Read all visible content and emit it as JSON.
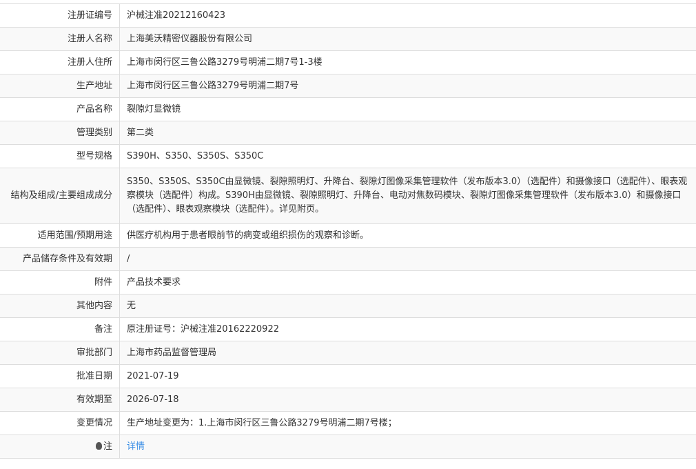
{
  "rows": [
    {
      "label": "注册证编号",
      "value": "沪械注准20212160423"
    },
    {
      "label": "注册人名称",
      "value": "上海美沃精密仪器股份有限公司"
    },
    {
      "label": "注册人住所",
      "value": "上海市闵行区三鲁公路3279号明浦二期7号1-3楼"
    },
    {
      "label": "生产地址",
      "value": "上海市闵行区三鲁公路3279号明浦二期7号"
    },
    {
      "label": "产品名称",
      "value": "裂隙灯显微镜"
    },
    {
      "label": "管理类别",
      "value": "第二类"
    },
    {
      "label": "型号规格",
      "value": "S390H、S350、S350S、S350C"
    },
    {
      "label": "结构及组成/主要组成成分",
      "value": "S350、S350S、S350C由显微镜、裂隙照明灯、升降台、裂隙灯图像采集管理软件（发布版本3.0）（选配件）和摄像接口（选配件）、眼表观察模块（选配件）构成。S390H由显微镜、裂隙照明灯、升降台、电动对焦数码模块、裂隙灯图像采集管理软件（发布版本3.0）和摄像接口（选配件）、眼表观察模块（选配件）。详见附页。"
    },
    {
      "label": "适用范围/预期用途",
      "value": "供医疗机构用于患者眼前节的病变或组织损伤的观察和诊断。"
    },
    {
      "label": "产品储存条件及有效期",
      "value": "/"
    },
    {
      "label": "附件",
      "value": "产品技术要求"
    },
    {
      "label": "其他内容",
      "value": "无"
    },
    {
      "label": "备注",
      "value": "原注册证号：沪械注准20162220922"
    },
    {
      "label": "审批部门",
      "value": "上海市药品监督管理局"
    },
    {
      "label": "批准日期",
      "value": "2021-07-19"
    },
    {
      "label": "有效期至",
      "value": "2026-07-18"
    },
    {
      "label": "变更情况",
      "value": "生产地址变更为：1.上海市闵行区三鲁公路3279号明浦二期7号楼；"
    }
  ],
  "note": {
    "label": "注",
    "link": "详情"
  }
}
